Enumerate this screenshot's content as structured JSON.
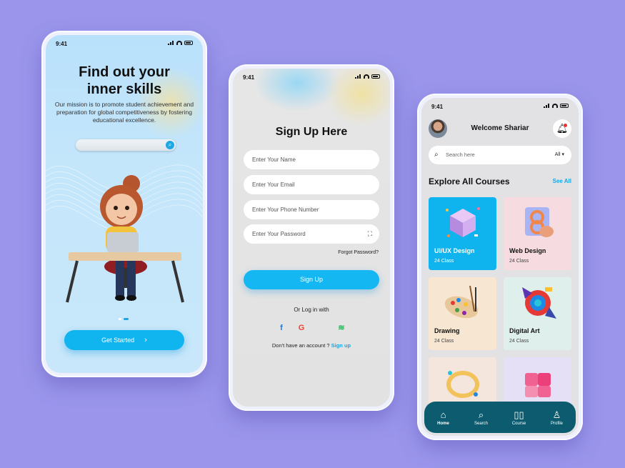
{
  "status_time": "9:41",
  "onboarding": {
    "title_line1": "Find out your",
    "title_line2": "inner skills",
    "description": "Our mission is to promote student achievement and preparation for global competitiveness by fostering educational excellence.",
    "button": "Get Started",
    "chevron": "›",
    "search_icon": "search-icon"
  },
  "signup": {
    "title": "Sign Up Here",
    "name_placeholder": "Enter Your Name",
    "email_placeholder": "Enter Your Email",
    "phone_placeholder": "Enter Your Phone Number",
    "password_placeholder": "Enter Your Password",
    "forgot": "Forgot Password?",
    "button": "Sign Up",
    "or_login": "Or Log in with",
    "no_account": "Don't have an account ?",
    "signup_link": "Sign up",
    "socials": [
      {
        "name": "facebook-icon",
        "glyph": "f",
        "color": "#1877f2"
      },
      {
        "name": "google-icon",
        "glyph": "G",
        "color": "#ea4335"
      },
      {
        "name": "apple-icon",
        "glyph": "",
        "color": "#111111"
      },
      {
        "name": "spotify-icon",
        "glyph": "≋",
        "color": "#1db954"
      }
    ]
  },
  "home": {
    "welcome": "Welcome Shariar",
    "search_placeholder": "Search here",
    "filter": "All ▾",
    "section_title": "Explore All Courses",
    "see_all": "See All",
    "courses": [
      {
        "name": "UI/UX Design",
        "count": "24 Class",
        "bg": "#0fb4ef"
      },
      {
        "name": "Web Design",
        "count": "24 Class",
        "bg": "#f6dbe0"
      },
      {
        "name": "Drawing",
        "count": "24 Class",
        "bg": "#f6e6d2"
      },
      {
        "name": "Digital Art",
        "count": "24 Class",
        "bg": "#dff0ec"
      },
      {
        "name": "",
        "count": "",
        "bg": "#f4e6dc"
      },
      {
        "name": "",
        "count": "",
        "bg": "#e6e0f6"
      }
    ],
    "nav": [
      {
        "label": "Home",
        "icon": "home-icon",
        "glyph": "⌂"
      },
      {
        "label": "Search",
        "icon": "search-icon",
        "glyph": "⌕"
      },
      {
        "label": "Course",
        "icon": "book-icon",
        "glyph": "▯▯"
      },
      {
        "label": "Profile",
        "icon": "profile-icon",
        "glyph": "♙"
      }
    ]
  }
}
